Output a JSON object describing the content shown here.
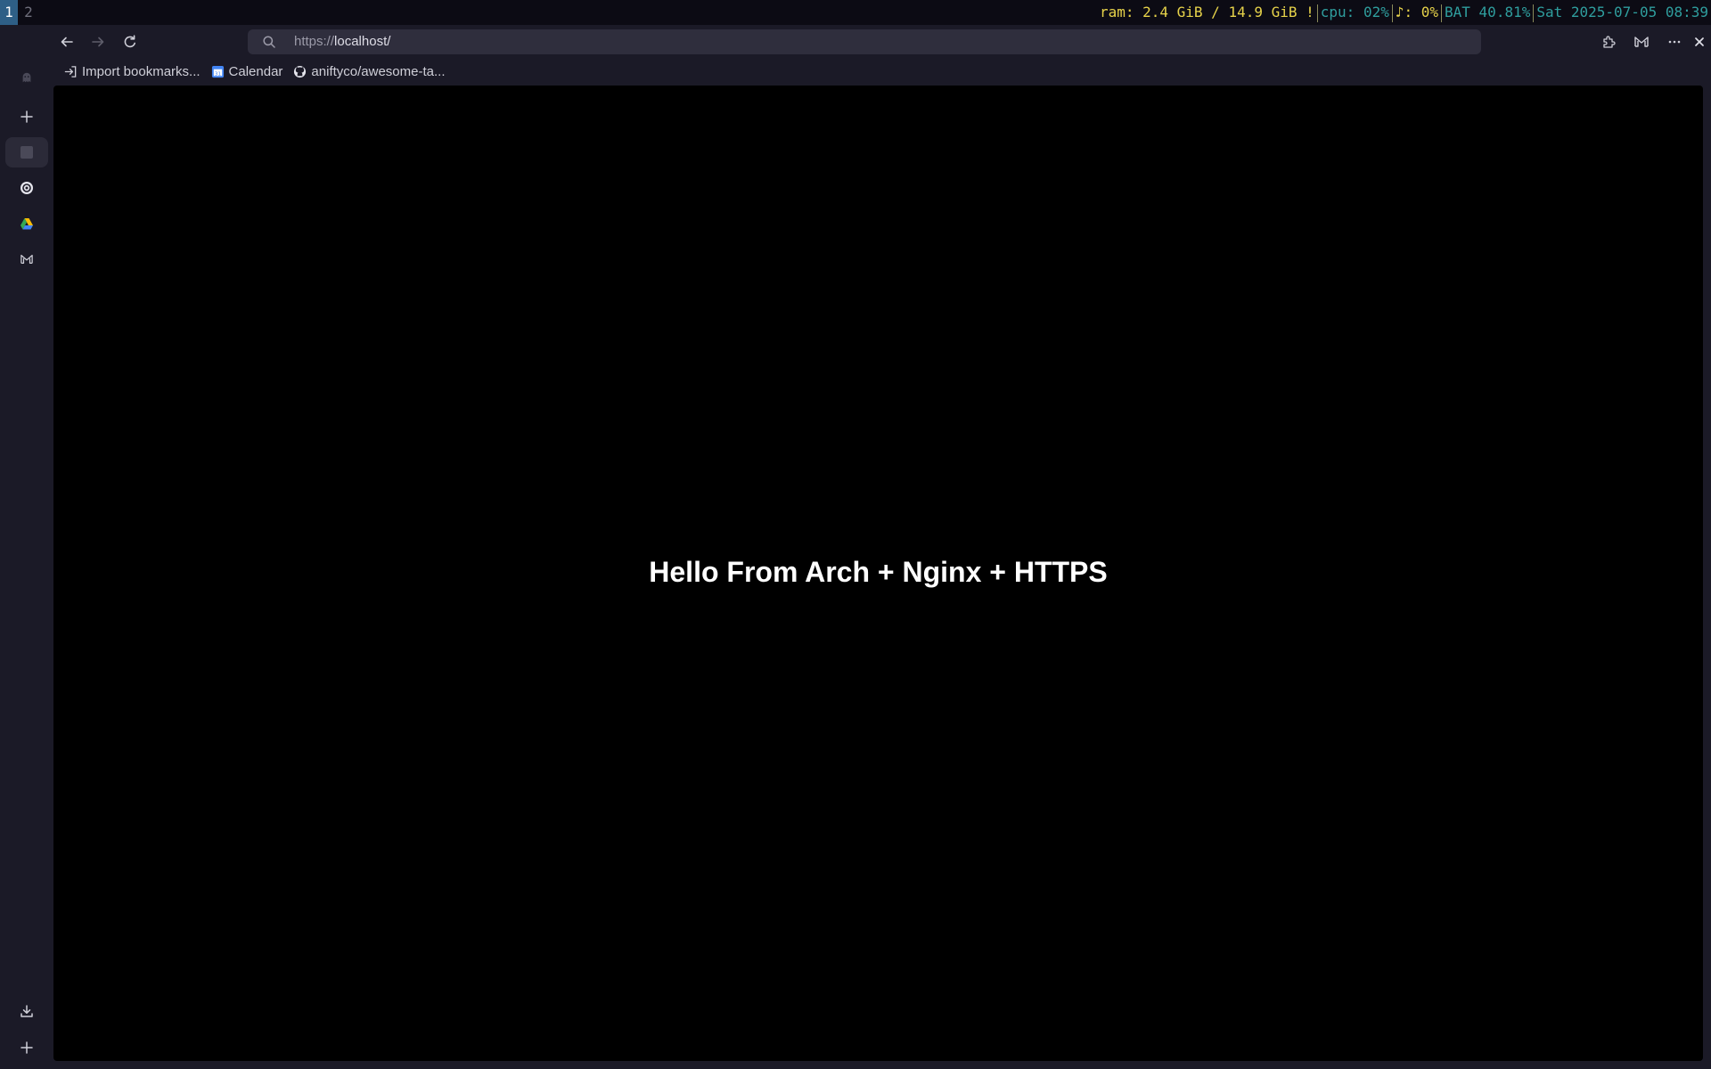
{
  "status_bar": {
    "workspaces": [
      "1",
      "2"
    ],
    "ram": "ram: 2.4 GiB / 14.9 GiB !",
    "cpu": "cpu: 02%",
    "volume": "♪: 0%",
    "battery": "BAT 40.81%",
    "datetime": "Sat 2025-07-05 08:39",
    "colors": {
      "ram": "#e7d34a",
      "cpu": "#2f9e9e",
      "volume": "#e7d34a",
      "battery": "#2f9e9e",
      "datetime": "#2f9e9e"
    }
  },
  "toolbar": {
    "url_scheme": "https://",
    "url_host": "localhost/",
    "icons": [
      "back-arrow-icon",
      "forward-arrow-icon",
      "reload-icon",
      "search-icon",
      "extensions-icon",
      "mail-icon",
      "more-options-icon",
      "close-icon"
    ]
  },
  "bookmarks": [
    {
      "label": "Import bookmarks...",
      "icon": "import-icon"
    },
    {
      "label": "Calendar",
      "icon": "calendar-icon"
    },
    {
      "label": "aniftyco/awesome-ta...",
      "icon": "github-icon"
    }
  ],
  "sidebar": {
    "icons": [
      "ghost-icon",
      "new-tab-plus-icon",
      "tab-square-icon",
      "openai-icon",
      "google-drive-icon",
      "gmail-icon",
      "download-icon",
      "add-icon"
    ]
  },
  "page": {
    "heading": "Hello From Arch + Nginx + HTTPS",
    "background": "#000000"
  }
}
